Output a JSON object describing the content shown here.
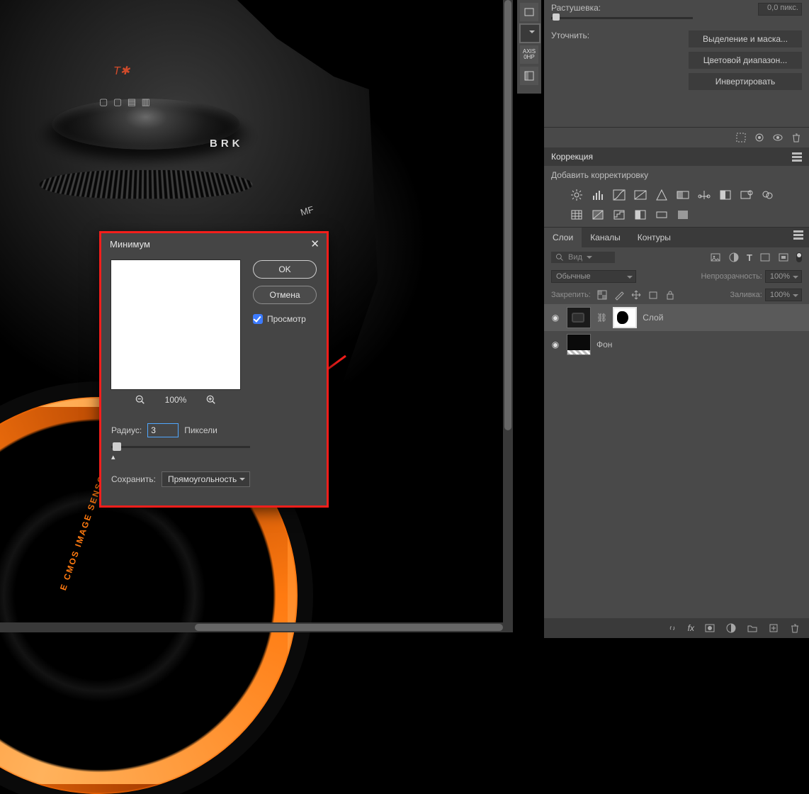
{
  "canvas": {
    "t_star_mark": "T✱",
    "dial_marks": "▢ ▢ ▤ ▥",
    "brk_label": "BRK",
    "mf_label": "MF",
    "lens_text": "E CMOS IMAGE SENSOR"
  },
  "dialog": {
    "title": "Минимум",
    "ok": "OK",
    "cancel": "Отмена",
    "preview_label": "Просмотр",
    "zoom_level": "100%",
    "radius_label": "Радиус:",
    "radius_value": "3",
    "radius_unit": "Пиксели",
    "preserve_label": "Сохранить:",
    "preserve_value": "Прямоугольность"
  },
  "props": {
    "feather_label": "Растушевка:",
    "feather_value": "0,0 пикс.",
    "refine_label": "Уточнить:",
    "buttons": {
      "select_mask": "Выделение и маска...",
      "color_range": "Цветовой диапазон...",
      "invert": "Инвертировать"
    }
  },
  "adjust": {
    "panel_title": "Коррекция",
    "add_label": "Добавить корректировку"
  },
  "layersPanel": {
    "tabs": {
      "layers": "Слои",
      "channels": "Каналы",
      "paths": "Контуры"
    },
    "search_placeholder": "Вид",
    "blend_mode": "Обычные",
    "opacity_label": "Непрозрачность:",
    "opacity_value": "100%",
    "lock_label": "Закрепить:",
    "fill_label": "Заливка:",
    "fill_value": "100%",
    "layer1_name": "Слой",
    "layer2_name": "Фон"
  }
}
